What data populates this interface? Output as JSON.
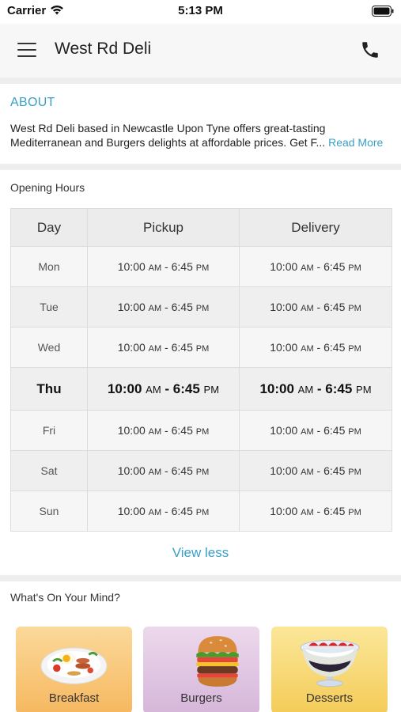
{
  "status_bar": {
    "carrier": "Carrier",
    "time": "5:13 PM"
  },
  "header": {
    "title": "West Rd Deli",
    "menu_icon": "hamburger-menu-icon",
    "call_icon": "phone-icon"
  },
  "about": {
    "heading": "ABOUT",
    "text_line1": "West Rd Deli based in Newcastle Upon Tyne offers great-tasting",
    "text_line2": "Mediterranean and Burgers delights at affordable prices. Get F...",
    "read_more": "Read More"
  },
  "opening_hours": {
    "label": "Opening Hours",
    "columns": [
      "Day",
      "Pickup",
      "Delivery"
    ],
    "rows": [
      {
        "day": "Mon",
        "pickup_open": "10:00",
        "pickup_close": "6:45",
        "delivery_open": "10:00",
        "delivery_close": "6:45",
        "today": false
      },
      {
        "day": "Tue",
        "pickup_open": "10:00",
        "pickup_close": "6:45",
        "delivery_open": "10:00",
        "delivery_close": "6:45",
        "today": false
      },
      {
        "day": "Wed",
        "pickup_open": "10:00",
        "pickup_close": "6:45",
        "delivery_open": "10:00",
        "delivery_close": "6:45",
        "today": false
      },
      {
        "day": "Thu",
        "pickup_open": "10:00",
        "pickup_close": "6:45",
        "delivery_open": "10:00",
        "delivery_close": "6:45",
        "today": true
      },
      {
        "day": "Fri",
        "pickup_open": "10:00",
        "pickup_close": "6:45",
        "delivery_open": "10:00",
        "delivery_close": "6:45",
        "today": false
      },
      {
        "day": "Sat",
        "pickup_open": "10:00",
        "pickup_close": "6:45",
        "delivery_open": "10:00",
        "delivery_close": "6:45",
        "today": false
      },
      {
        "day": "Sun",
        "pickup_open": "10:00",
        "pickup_close": "6:45",
        "delivery_open": "10:00",
        "delivery_close": "6:45",
        "today": false
      }
    ],
    "am": "AM",
    "pm": "PM",
    "view_less": "View less"
  },
  "categories": {
    "label": "What's On Your Mind?",
    "items": [
      {
        "label": "Breakfast",
        "icon": "breakfast-plate-icon"
      },
      {
        "label": "Burgers",
        "icon": "burger-icon"
      },
      {
        "label": "Desserts",
        "icon": "dessert-bowl-icon"
      }
    ]
  },
  "colors": {
    "accent": "#3a9fc6",
    "header_bg": "#f7f7f7",
    "table_header_bg": "#ececec"
  }
}
